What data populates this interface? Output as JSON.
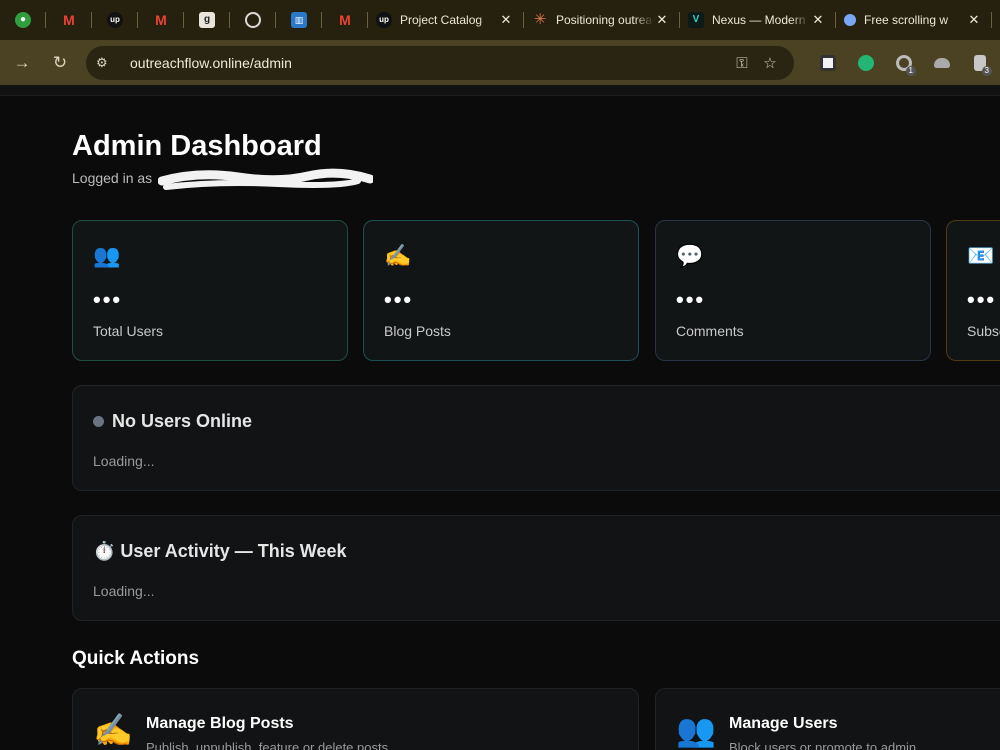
{
  "browser": {
    "pinned_tabs": [
      {
        "icon": "green-leaf-icon",
        "color": "#2e9e3e"
      },
      {
        "icon": "gmail-icon",
        "color": "#ea4335"
      },
      {
        "icon": "upwork-icon",
        "color": "#111111"
      },
      {
        "icon": "gmail-icon",
        "color": "#ea4335"
      },
      {
        "icon": "g-letter-icon",
        "color": "#e8e4da"
      },
      {
        "icon": "openai-icon",
        "color": "#d9d9d9"
      },
      {
        "icon": "blue-document-icon",
        "color": "#2a79c9"
      },
      {
        "icon": "gmail-icon",
        "color": "#ea4335"
      }
    ],
    "tabs": [
      {
        "title": "Project Catalog",
        "icon": "upwork-icon"
      },
      {
        "title": "Positioning outreach",
        "icon": "asterisk-icon"
      },
      {
        "title": "Nexus — Modern",
        "icon": "nexus-icon"
      },
      {
        "title": "Free scrolling w",
        "icon": "blue-circle-icon"
      }
    ],
    "url": "outreachflow.online/admin",
    "extension_badges": {
      "ext3": "1",
      "ext5": "3"
    }
  },
  "page": {
    "title": "Admin Dashboard",
    "logged_in_prefix": "Logged in as"
  },
  "stats": [
    {
      "icon_glyph": "👥",
      "value": "•••",
      "label": "Total Users",
      "border": "#1f4e43"
    },
    {
      "icon_glyph": "✍️",
      "value": "•••",
      "label": "Blog Posts",
      "border": "#1d4f55"
    },
    {
      "icon_glyph": "💬",
      "value": "•••",
      "label": "Comments",
      "border": "#2b3548"
    },
    {
      "icon_glyph": "📧",
      "value": "•••",
      "label": "Subscribers",
      "border": "#4f3b16"
    }
  ],
  "online_panel": {
    "title": "No Users Online",
    "status": "Loading..."
  },
  "activity_panel": {
    "title": "⏱️ User Activity — This Week",
    "status": "Loading..."
  },
  "quick_actions": {
    "title": "Quick Actions",
    "items": [
      {
        "icon_glyph": "✍️",
        "title": "Manage Blog Posts",
        "desc": "Publish, unpublish, feature or delete posts"
      },
      {
        "icon_glyph": "👥",
        "title": "Manage Users",
        "desc": "Block users or promote to admin"
      }
    ]
  }
}
